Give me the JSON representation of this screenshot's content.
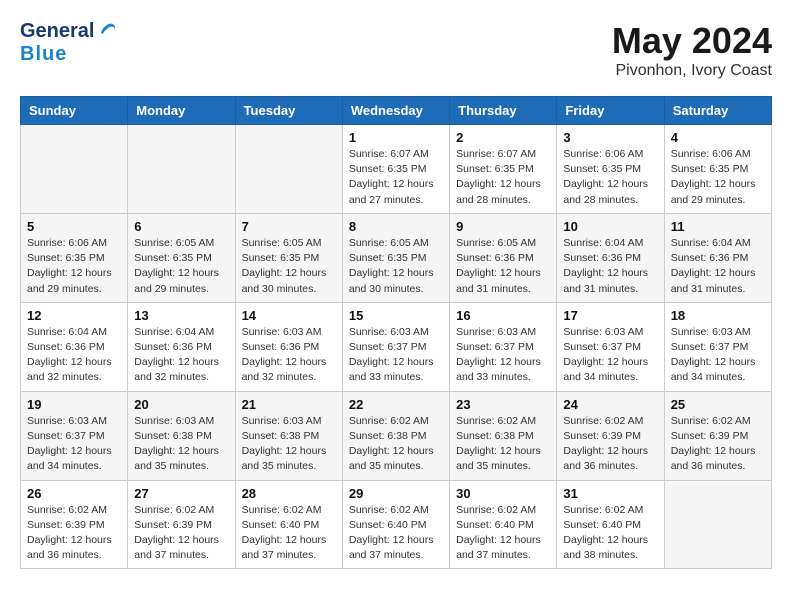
{
  "header": {
    "logo_line1": "General",
    "logo_line2": "Blue",
    "title": "May 2024",
    "subtitle": "Pivonhon, Ivory Coast"
  },
  "calendar": {
    "days_of_week": [
      "Sunday",
      "Monday",
      "Tuesday",
      "Wednesday",
      "Thursday",
      "Friday",
      "Saturday"
    ],
    "weeks": [
      [
        {
          "day": "",
          "sunrise": "",
          "sunset": "",
          "daylight": ""
        },
        {
          "day": "",
          "sunrise": "",
          "sunset": "",
          "daylight": ""
        },
        {
          "day": "",
          "sunrise": "",
          "sunset": "",
          "daylight": ""
        },
        {
          "day": "1",
          "sunrise": "Sunrise: 6:07 AM",
          "sunset": "Sunset: 6:35 PM",
          "daylight": "Daylight: 12 hours and 27 minutes."
        },
        {
          "day": "2",
          "sunrise": "Sunrise: 6:07 AM",
          "sunset": "Sunset: 6:35 PM",
          "daylight": "Daylight: 12 hours and 28 minutes."
        },
        {
          "day": "3",
          "sunrise": "Sunrise: 6:06 AM",
          "sunset": "Sunset: 6:35 PM",
          "daylight": "Daylight: 12 hours and 28 minutes."
        },
        {
          "day": "4",
          "sunrise": "Sunrise: 6:06 AM",
          "sunset": "Sunset: 6:35 PM",
          "daylight": "Daylight: 12 hours and 29 minutes."
        }
      ],
      [
        {
          "day": "5",
          "sunrise": "Sunrise: 6:06 AM",
          "sunset": "Sunset: 6:35 PM",
          "daylight": "Daylight: 12 hours and 29 minutes."
        },
        {
          "day": "6",
          "sunrise": "Sunrise: 6:05 AM",
          "sunset": "Sunset: 6:35 PM",
          "daylight": "Daylight: 12 hours and 29 minutes."
        },
        {
          "day": "7",
          "sunrise": "Sunrise: 6:05 AM",
          "sunset": "Sunset: 6:35 PM",
          "daylight": "Daylight: 12 hours and 30 minutes."
        },
        {
          "day": "8",
          "sunrise": "Sunrise: 6:05 AM",
          "sunset": "Sunset: 6:35 PM",
          "daylight": "Daylight: 12 hours and 30 minutes."
        },
        {
          "day": "9",
          "sunrise": "Sunrise: 6:05 AM",
          "sunset": "Sunset: 6:36 PM",
          "daylight": "Daylight: 12 hours and 31 minutes."
        },
        {
          "day": "10",
          "sunrise": "Sunrise: 6:04 AM",
          "sunset": "Sunset: 6:36 PM",
          "daylight": "Daylight: 12 hours and 31 minutes."
        },
        {
          "day": "11",
          "sunrise": "Sunrise: 6:04 AM",
          "sunset": "Sunset: 6:36 PM",
          "daylight": "Daylight: 12 hours and 31 minutes."
        }
      ],
      [
        {
          "day": "12",
          "sunrise": "Sunrise: 6:04 AM",
          "sunset": "Sunset: 6:36 PM",
          "daylight": "Daylight: 12 hours and 32 minutes."
        },
        {
          "day": "13",
          "sunrise": "Sunrise: 6:04 AM",
          "sunset": "Sunset: 6:36 PM",
          "daylight": "Daylight: 12 hours and 32 minutes."
        },
        {
          "day": "14",
          "sunrise": "Sunrise: 6:03 AM",
          "sunset": "Sunset: 6:36 PM",
          "daylight": "Daylight: 12 hours and 32 minutes."
        },
        {
          "day": "15",
          "sunrise": "Sunrise: 6:03 AM",
          "sunset": "Sunset: 6:37 PM",
          "daylight": "Daylight: 12 hours and 33 minutes."
        },
        {
          "day": "16",
          "sunrise": "Sunrise: 6:03 AM",
          "sunset": "Sunset: 6:37 PM",
          "daylight": "Daylight: 12 hours and 33 minutes."
        },
        {
          "day": "17",
          "sunrise": "Sunrise: 6:03 AM",
          "sunset": "Sunset: 6:37 PM",
          "daylight": "Daylight: 12 hours and 34 minutes."
        },
        {
          "day": "18",
          "sunrise": "Sunrise: 6:03 AM",
          "sunset": "Sunset: 6:37 PM",
          "daylight": "Daylight: 12 hours and 34 minutes."
        }
      ],
      [
        {
          "day": "19",
          "sunrise": "Sunrise: 6:03 AM",
          "sunset": "Sunset: 6:37 PM",
          "daylight": "Daylight: 12 hours and 34 minutes."
        },
        {
          "day": "20",
          "sunrise": "Sunrise: 6:03 AM",
          "sunset": "Sunset: 6:38 PM",
          "daylight": "Daylight: 12 hours and 35 minutes."
        },
        {
          "day": "21",
          "sunrise": "Sunrise: 6:03 AM",
          "sunset": "Sunset: 6:38 PM",
          "daylight": "Daylight: 12 hours and 35 minutes."
        },
        {
          "day": "22",
          "sunrise": "Sunrise: 6:02 AM",
          "sunset": "Sunset: 6:38 PM",
          "daylight": "Daylight: 12 hours and 35 minutes."
        },
        {
          "day": "23",
          "sunrise": "Sunrise: 6:02 AM",
          "sunset": "Sunset: 6:38 PM",
          "daylight": "Daylight: 12 hours and 35 minutes."
        },
        {
          "day": "24",
          "sunrise": "Sunrise: 6:02 AM",
          "sunset": "Sunset: 6:39 PM",
          "daylight": "Daylight: 12 hours and 36 minutes."
        },
        {
          "day": "25",
          "sunrise": "Sunrise: 6:02 AM",
          "sunset": "Sunset: 6:39 PM",
          "daylight": "Daylight: 12 hours and 36 minutes."
        }
      ],
      [
        {
          "day": "26",
          "sunrise": "Sunrise: 6:02 AM",
          "sunset": "Sunset: 6:39 PM",
          "daylight": "Daylight: 12 hours and 36 minutes."
        },
        {
          "day": "27",
          "sunrise": "Sunrise: 6:02 AM",
          "sunset": "Sunset: 6:39 PM",
          "daylight": "Daylight: 12 hours and 37 minutes."
        },
        {
          "day": "28",
          "sunrise": "Sunrise: 6:02 AM",
          "sunset": "Sunset: 6:40 PM",
          "daylight": "Daylight: 12 hours and 37 minutes."
        },
        {
          "day": "29",
          "sunrise": "Sunrise: 6:02 AM",
          "sunset": "Sunset: 6:40 PM",
          "daylight": "Daylight: 12 hours and 37 minutes."
        },
        {
          "day": "30",
          "sunrise": "Sunrise: 6:02 AM",
          "sunset": "Sunset: 6:40 PM",
          "daylight": "Daylight: 12 hours and 37 minutes."
        },
        {
          "day": "31",
          "sunrise": "Sunrise: 6:02 AM",
          "sunset": "Sunset: 6:40 PM",
          "daylight": "Daylight: 12 hours and 38 minutes."
        },
        {
          "day": "",
          "sunrise": "",
          "sunset": "",
          "daylight": ""
        }
      ]
    ]
  }
}
